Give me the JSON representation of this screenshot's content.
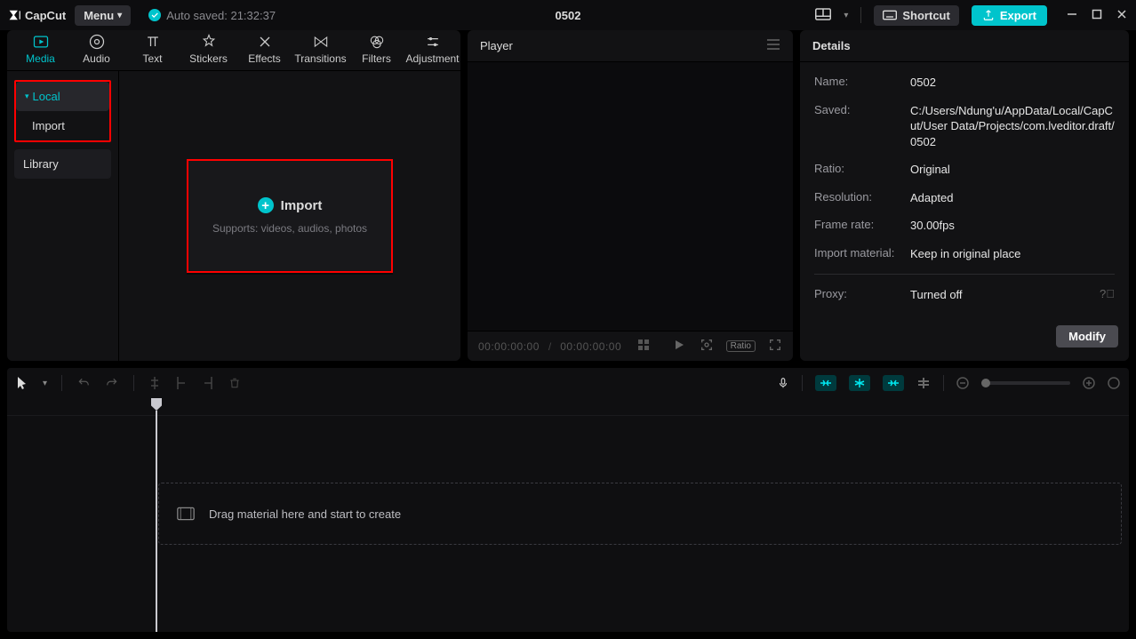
{
  "titlebar": {
    "app_name": "CapCut",
    "menu_label": "Menu",
    "autosave_text": "Auto saved: 21:32:37",
    "project_title": "0502",
    "shortcut_label": "Shortcut",
    "export_label": "Export"
  },
  "tool_tabs": {
    "media": "Media",
    "audio": "Audio",
    "text": "Text",
    "stickers": "Stickers",
    "effects": "Effects",
    "transitions": "Transitions",
    "filters": "Filters",
    "adjustment": "Adjustment"
  },
  "sidebar": {
    "local": "Local",
    "import": "Import",
    "library": "Library"
  },
  "import_box": {
    "title": "Import",
    "subtitle": "Supports: videos, audios, photos"
  },
  "player": {
    "title": "Player",
    "tc_current": "00:00:00:00",
    "tc_total": "00:00:00:00",
    "ratio_label": "Ratio"
  },
  "details": {
    "title": "Details",
    "rows": {
      "name_k": "Name:",
      "name_v": "0502",
      "saved_k": "Saved:",
      "saved_v": "C:/Users/Ndung'u/AppData/Local/CapCut/User Data/Projects/com.lveditor.draft/0502",
      "ratio_k": "Ratio:",
      "ratio_v": "Original",
      "res_k": "Resolution:",
      "res_v": "Adapted",
      "fps_k": "Frame rate:",
      "fps_v": "30.00fps",
      "imp_k": "Import material:",
      "imp_v": "Keep in original place",
      "proxy_k": "Proxy:",
      "proxy_v": "Turned off"
    },
    "modify_label": "Modify"
  },
  "timeline": {
    "drop_hint": "Drag material here and start to create"
  }
}
